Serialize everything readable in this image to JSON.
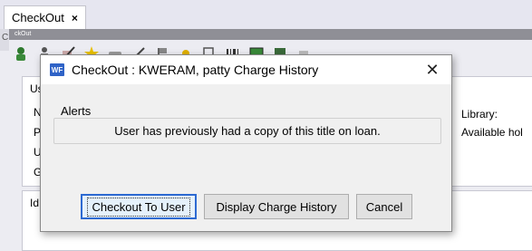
{
  "tab": {
    "title": "CheckOut",
    "close": "×"
  },
  "strip": {
    "caption": "ckOut",
    "edge": "C"
  },
  "toolbar": {
    "icons": [
      "person-icon",
      "stamp-icon",
      "edit-icon",
      "star-icon",
      "car-icon",
      "pen-icon",
      "flag-icon",
      "sparkle-icon",
      "copy-icon",
      "barcode-icon",
      "screen-icon",
      "book-icon",
      "tag-icon"
    ]
  },
  "background": {
    "group_label": "Us",
    "letters": [
      "N",
      "P",
      "U",
      "G"
    ],
    "id_label": "Id",
    "library_label": "Library:",
    "available_label": "Available hol"
  },
  "dialog": {
    "app_icon": "WF",
    "title": "CheckOut : KWERAM, patty  Charge History",
    "close": "✕",
    "alerts_legend": "Alerts",
    "alerts_message": "User has previously had a copy of this title on loan.",
    "buttons": {
      "checkout": "Checkout To User",
      "history": "Display Charge History",
      "cancel": "Cancel"
    }
  },
  "colors": {
    "accent": "#2d6ad2",
    "app_icon": "#2f63c7"
  }
}
